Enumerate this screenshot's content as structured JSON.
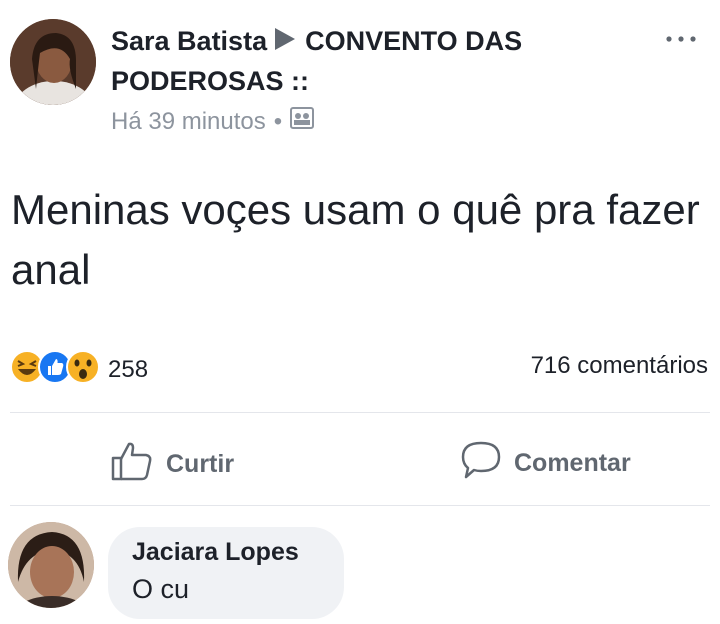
{
  "post": {
    "author": "Sara Batista",
    "group": "CONVENTO DAS PODEROSAS ::",
    "timestamp": "Há 39 minutos",
    "separator": "•",
    "audience_icon": "group-icon",
    "text": "Meninas voçes usam  o quê pra fazer anal"
  },
  "engagement": {
    "reaction_icons": [
      "haha-emoji-icon",
      "like-emoji-icon",
      "wow-emoji-icon"
    ],
    "reaction_count": "258",
    "comments_count": "716 comentários"
  },
  "actions": {
    "like_label": "Curtir",
    "comment_label": "Comentar"
  },
  "comment": {
    "author": "Jaciara Lopes",
    "text": "O cu"
  },
  "colors": {
    "text_primary": "#1d2129",
    "text_secondary": "#606770",
    "meta_gray": "#8d949e",
    "like_blue": "#1877f2",
    "emoji_yellow": "#f7b125",
    "bubble_bg": "#f0f2f5"
  }
}
